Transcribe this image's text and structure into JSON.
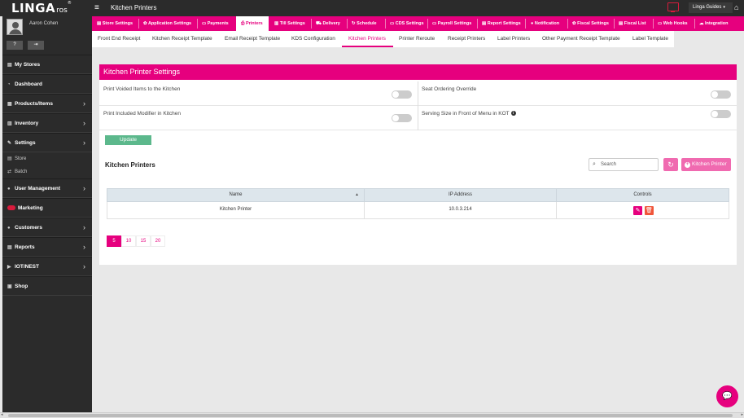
{
  "topbar": {
    "logo_main": "LINGA",
    "logo_ros": "ros",
    "logo_reg": "®",
    "page_title": "Kitchen Printers",
    "guides_label": "Linga Guides",
    "hamburger": "≡",
    "home_glyph": "⌂",
    "caret": "▾"
  },
  "sidebar": {
    "username": "Aaron Cohen",
    "btn_help": "?",
    "btn_logout": "⇥",
    "items": [
      {
        "label": "My Stores",
        "icon": "▤",
        "chevron": ""
      },
      {
        "label": "Dashboard",
        "icon": "◔",
        "chevron": ""
      },
      {
        "label": "Products/Items",
        "icon": "▦",
        "chevron": "›"
      },
      {
        "label": "Inventory",
        "icon": "▥",
        "chevron": "›"
      },
      {
        "label": "Settings",
        "icon": "✎",
        "chevron": "›"
      },
      {
        "label": "Store",
        "icon": "▤"
      },
      {
        "label": "Batch",
        "icon": "⇄"
      },
      {
        "label": "User Management",
        "icon": "●",
        "chevron": "›"
      },
      {
        "label": "Marketing",
        "icon": ""
      },
      {
        "label": "Customers",
        "icon": "●",
        "chevron": "›"
      },
      {
        "label": "Reports",
        "icon": "▤",
        "chevron": "›"
      },
      {
        "label": "IOT/NEST",
        "icon": "▶",
        "chevron": "›"
      },
      {
        "label": "Shop",
        "icon": "▣",
        "chevron": ""
      }
    ]
  },
  "menubar": {
    "items": [
      {
        "label": "Store Settings",
        "icon": "▤"
      },
      {
        "label": "Application Settings",
        "icon": "✿"
      },
      {
        "label": "Payments",
        "icon": "▭"
      },
      {
        "label": "Printers",
        "icon": "⎙"
      },
      {
        "label": "Till Settings",
        "icon": "▥"
      },
      {
        "label": "Delivery",
        "icon": "⛟"
      },
      {
        "label": "Schedule",
        "icon": "↻"
      },
      {
        "label": "CDS Settings",
        "icon": "▭"
      },
      {
        "label": "Payroll Settings",
        "icon": "▭"
      },
      {
        "label": "Report Settings",
        "icon": "▤"
      },
      {
        "label": "Notification",
        "icon": "●"
      },
      {
        "label": "Fiscal Settings",
        "icon": "✿"
      },
      {
        "label": "Fiscal List",
        "icon": "▤"
      },
      {
        "label": "Web Hooks",
        "icon": "▭"
      },
      {
        "label": "Integration",
        "icon": "☁"
      }
    ]
  },
  "subtabs": {
    "items": [
      "Front End Receipt",
      "Kitchen Receipt Template",
      "Email Receipt Template",
      "KDS Configuration",
      "Kitchen Printers",
      "Printer Reroute",
      "Receipt Printers",
      "Label Printers",
      "Other Payment Receipt Template",
      "Label Template"
    ]
  },
  "settings": {
    "header": "Kitchen Printer Settings",
    "print_voided": "Print Voided Items to the Kitchen",
    "seat_override": "Seat Ordering Override",
    "print_modifier": "Print Included Modifier in Kitchen",
    "serving_size": "Serving Size in Front of Menu in KOT",
    "info": "i",
    "update": "Update"
  },
  "printers": {
    "title": "Kitchen Printers",
    "search_placeholder": "Search",
    "search_icon": "⌕",
    "refresh_icon": "↻",
    "add_plus": "+",
    "add_label": "Kitchen Printer",
    "columns": [
      "Name",
      "IP Address",
      "Controls"
    ],
    "sort_glyph": "▲",
    "rows": [
      {
        "name": "Kitchen Printer",
        "ip": "10.0.3.214"
      }
    ],
    "edit_glyph": "✎",
    "delete_glyph": "🗑",
    "page_sizes": [
      "5",
      "10",
      "15",
      "20"
    ]
  },
  "chat": {
    "glyph": "💬"
  },
  "scroll": {
    "left": "◂",
    "right": "▸"
  }
}
